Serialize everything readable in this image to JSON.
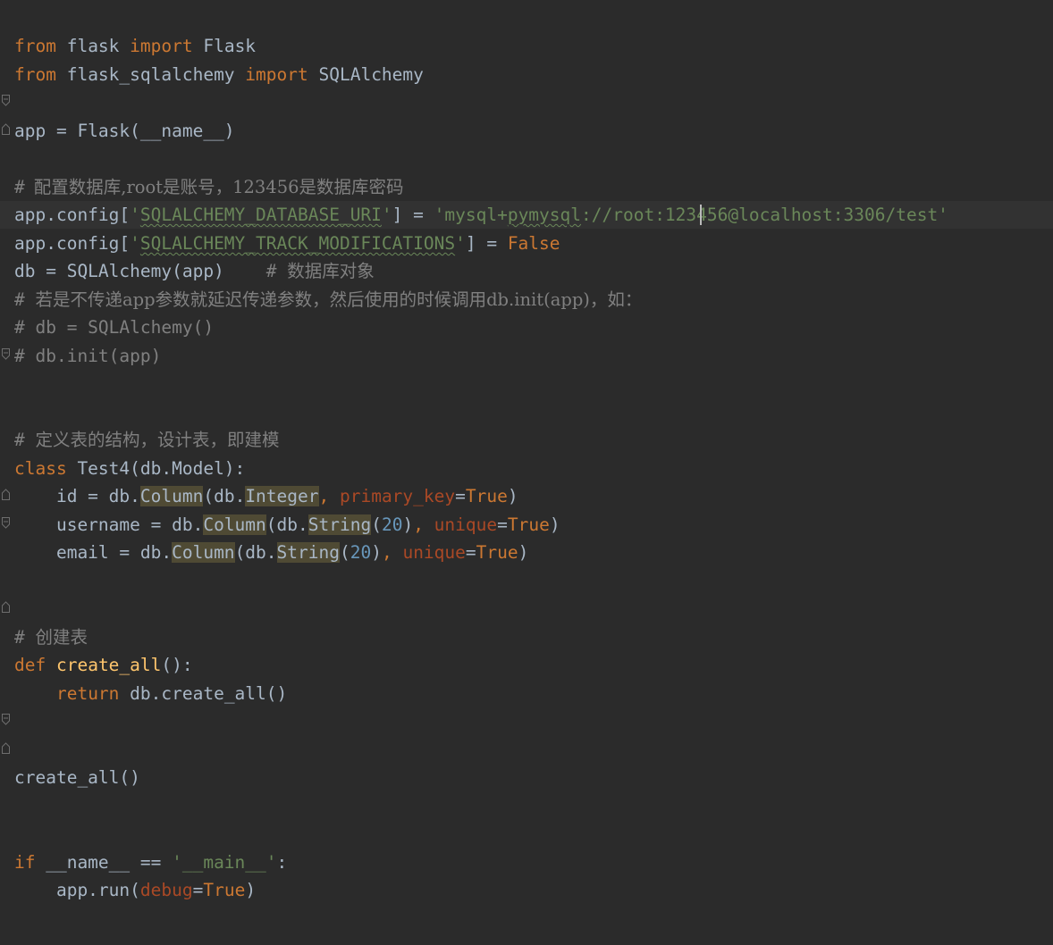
{
  "editor": {
    "language": "python",
    "theme_colors": {
      "background": "#2b2b2b",
      "current_line": "#323232",
      "keyword": "#cc7832",
      "string": "#6a8759",
      "number": "#6897bb",
      "comment": "#808080",
      "parameter": "#aa4926",
      "function": "#ffc66d",
      "default_text": "#a9b7c6"
    },
    "lines": {
      "l1": {
        "kw1": "from",
        "t1": " flask ",
        "kw2": "import",
        "t2": " Flask"
      },
      "l2": {
        "kw1": "from",
        "t1": " flask_sqlalchemy ",
        "kw2": "import",
        "t2": " SQLAlchemy"
      },
      "l3": {
        "t1": "app = Flask(__name__)"
      },
      "l4": {
        "hash": "#",
        "text": "配置数据库,root是账号，123456是数据库密码"
      },
      "l5": {
        "t1": "app.config[",
        "s1": "'",
        "s2": "SQLALCHEMY_DATABASE_URI",
        "s3": "'",
        "t2": "] = ",
        "s4": "'mysql+",
        "s5": "pymysql",
        "s6": "://root:12",
        "s7": "3456@localhost:3306/test'"
      },
      "l6": {
        "t1": "app.config[",
        "s1": "'",
        "s2": "SQLALCHEMY_TRACK_MODIFICATIONS",
        "s3": "'",
        "t2": "] = ",
        "kw1": "False"
      },
      "l7": {
        "t1": "db = SQLAlchemy(app)    ",
        "c1": "# ",
        "c2": "数据库对象"
      },
      "l8": {
        "c1": "# ",
        "c2": "若是不传递app参数就延迟传递参数，然后使用的时候调用db.init(app)，如："
      },
      "l9": {
        "c1": "# db = SQLAlchemy()"
      },
      "l10": {
        "c1": "# db.init(app)"
      },
      "l11": {
        "c1": "# ",
        "c2": "定义表的结构，设计表，即建模"
      },
      "l12": {
        "kw1": "class",
        "t1": " Test4(db.Model):"
      },
      "l13": {
        "t1": "    id = db.",
        "h1": "Column",
        "t2": "(db.",
        "h2": "Integer",
        "kw1": ", ",
        "p1": "primary_key",
        "t3": "=",
        "kw2": "True",
        "t4": ")"
      },
      "l14": {
        "t1": "    username = db.",
        "h1": "Column",
        "t2": "(db.",
        "h2": "String",
        "t3": "(",
        "n1": "20",
        "t4": ")",
        "kw1": ", ",
        "p1": "unique",
        "t5": "=",
        "kw2": "True",
        "t6": ")"
      },
      "l15": {
        "t1": "    email = db.",
        "h1": "Column",
        "t2": "(db.",
        "h2": "String",
        "t3": "(",
        "n1": "20",
        "t4": ")",
        "kw1": ", ",
        "p1": "unique",
        "t5": "=",
        "kw2": "True",
        "t6": ")"
      },
      "l16": {
        "c1": "# ",
        "c2": "创建表"
      },
      "l17": {
        "kw1": "def",
        "t1": " ",
        "f1": "create_all",
        "t2": "():"
      },
      "l18": {
        "t0": "    ",
        "kw1": "return",
        "t1": " db.create_all()"
      },
      "l19": {
        "t1": "create_all()"
      },
      "l20": {
        "kw1": "if",
        "t1": " __name__ == ",
        "s1": "'__main__'",
        "t2": ":"
      },
      "l21": {
        "t1": "    app.run(",
        "p1": "debug",
        "t2": "=",
        "kw1": "True",
        "t3": ")"
      }
    },
    "icons": {
      "fold_marker": "fold-icon",
      "intention_bulb": "lightbulb-icon"
    }
  }
}
